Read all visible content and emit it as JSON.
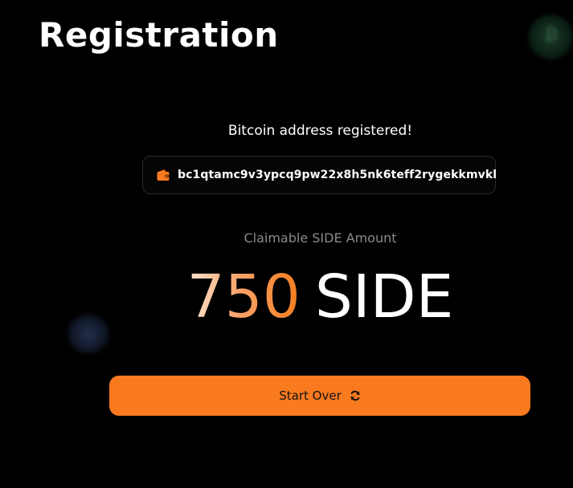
{
  "header": {
    "title": "Registration"
  },
  "registration": {
    "status": "Bitcoin address registered!",
    "address": "bc1qtamc9v3ypcq9pw22x8h5nk6teff2rygekkmvkl",
    "claim_label": "Claimable SIDE Amount",
    "amount": "750",
    "unit": "SIDE"
  },
  "actions": {
    "start_over_label": "Start Over"
  },
  "icons": {
    "wallet": "wallet-icon",
    "refresh": "refresh-icon",
    "coin": "bitcoin-coin-icon"
  },
  "colors": {
    "background": "#000000",
    "accent": "#f97a1f",
    "text": "#ffffff",
    "muted": "#8a8a8a",
    "border": "#2a2a2a"
  }
}
